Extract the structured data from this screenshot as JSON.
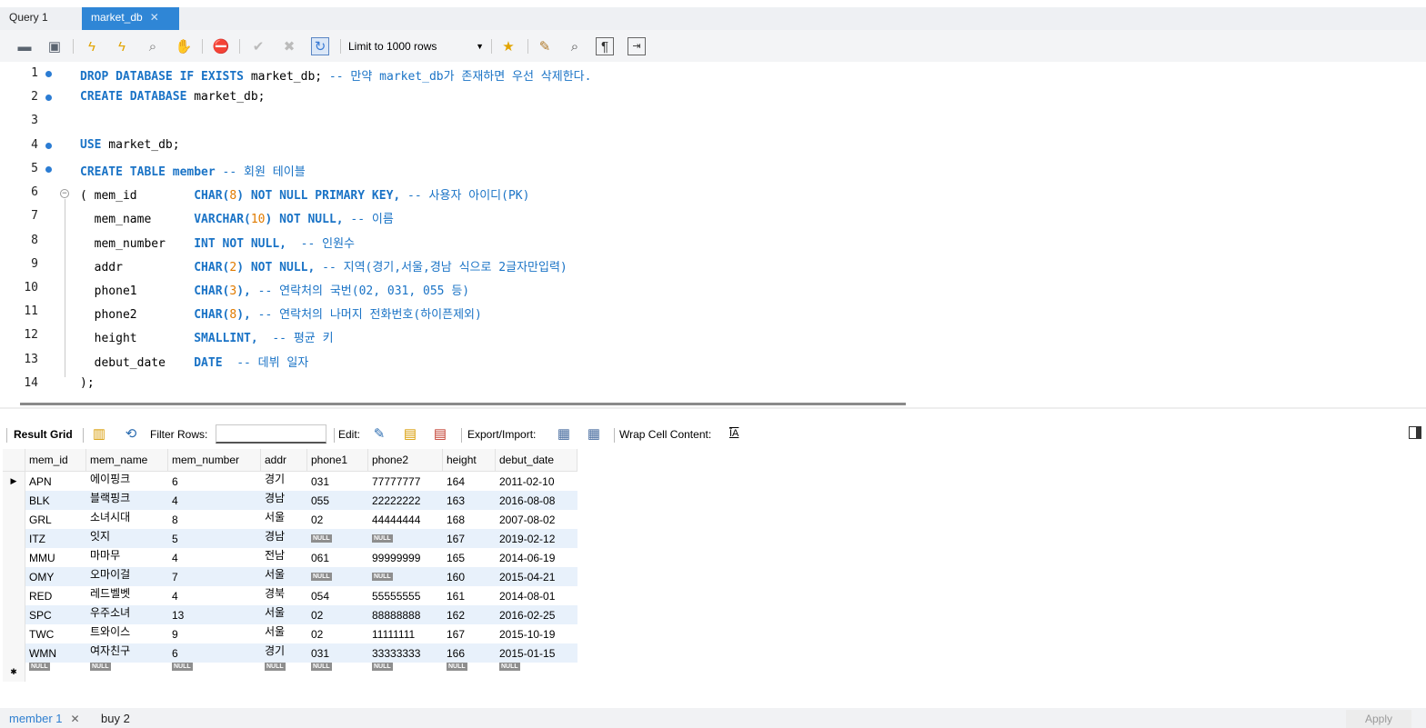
{
  "tabs": [
    {
      "label": "Query 1"
    },
    {
      "label": "market_db"
    }
  ],
  "toolbar": {
    "icons": [
      "open-folder-icon",
      "save-icon",
      "execute-icon",
      "execute-current-icon",
      "explain-icon",
      "stop-icon",
      "toggle-error-icon",
      "commit-icon",
      "rollback-icon",
      "autocommit-icon",
      "beautify-icon",
      "search-icon",
      "invisible-chars-icon",
      "wrap-icon"
    ],
    "limit_label": "Limit to 1000 rows"
  },
  "editor": {
    "lines": [
      {
        "n": "1",
        "dot": true
      },
      {
        "n": "2",
        "dot": true
      },
      {
        "n": "3",
        "dot": false
      },
      {
        "n": "4",
        "dot": true
      },
      {
        "n": "5",
        "dot": true
      },
      {
        "n": "6",
        "dot": false
      },
      {
        "n": "7",
        "dot": false
      },
      {
        "n": "8",
        "dot": false
      },
      {
        "n": "9",
        "dot": false
      },
      {
        "n": "10",
        "dot": false
      },
      {
        "n": "11",
        "dot": false
      },
      {
        "n": "12",
        "dot": false
      },
      {
        "n": "13",
        "dot": false
      },
      {
        "n": "14",
        "dot": false
      }
    ],
    "code": {
      "l1_kw": "DROP DATABASE IF EXISTS",
      "l1_id": " market_db;",
      "l1_cm": " -- 만약 market_db가 존재하면 우선 삭제한다.",
      "l2_kw": "CREATE DATABASE",
      "l2_id": " market_db;",
      "l4_kw": "USE",
      "l4_id": " market_db;",
      "l5_kw": "CREATE TABLE member",
      "l5_cm": " -- 회원 테이블",
      "l6_a": "( mem_id        ",
      "l6_kw1": "CHAR(",
      "l6_num": "8",
      "l6_kw2": ") NOT NULL PRIMARY KEY,",
      "l6_cm": " -- 사용자 아이디(PK)",
      "l7_a": "  mem_name      ",
      "l7_kw1": "VARCHAR(",
      "l7_num": "10",
      "l7_kw2": ") NOT NULL,",
      "l7_cm": " -- 이름",
      "l8_a": "  mem_number    ",
      "l8_kw": "INT NOT NULL,",
      "l8_cm": "  -- 인원수",
      "l9_a": "  addr          ",
      "l9_kw1": "CHAR(",
      "l9_num": "2",
      "l9_kw2": ") NOT NULL,",
      "l9_cm": " -- 지역(경기,서울,경남 식으로 2글자만입력)",
      "l10_a": "  phone1        ",
      "l10_kw1": "CHAR(",
      "l10_num": "3",
      "l10_kw2": "),",
      "l10_cm": " -- 연락처의 국번(02, 031, 055 등)",
      "l11_a": "  phone2        ",
      "l11_kw1": "CHAR(",
      "l11_num": "8",
      "l11_kw2": "),",
      "l11_cm": " -- 연락처의 나머지 전화번호(하이픈제외)",
      "l12_a": "  height        ",
      "l12_kw": "SMALLINT,",
      "l12_cm": "  -- 평균 키",
      "l13_a": "  debut_date    ",
      "l13_kw": "DATE",
      "l13_cm": "  -- 데뷔 일자",
      "l14_a": ");"
    }
  },
  "result_toolbar": {
    "result_grid": "Result Grid",
    "filter_rows": "Filter Rows:",
    "edit": "Edit:",
    "export_import": "Export/Import:",
    "wrap": "Wrap Cell Content:",
    "wrap_icon_glyph": "ĪA"
  },
  "grid": {
    "columns": [
      "mem_id",
      "mem_name",
      "mem_number",
      "addr",
      "phone1",
      "phone2",
      "height",
      "debut_date"
    ],
    "null_label": "NULL",
    "rows": [
      [
        "APN",
        "에이핑크",
        "6",
        "경기",
        "031",
        "77777777",
        "164",
        "2011-02-10"
      ],
      [
        "BLK",
        "블랙핑크",
        "4",
        "경남",
        "055",
        "22222222",
        "163",
        "2016-08-08"
      ],
      [
        "GRL",
        "소녀시대",
        "8",
        "서울",
        "02",
        "44444444",
        "168",
        "2007-08-02"
      ],
      [
        "ITZ",
        "잇지",
        "5",
        "경남",
        null,
        null,
        "167",
        "2019-02-12"
      ],
      [
        "MMU",
        "마마무",
        "4",
        "전남",
        "061",
        "99999999",
        "165",
        "2014-06-19"
      ],
      [
        "OMY",
        "오마이걸",
        "7",
        "서울",
        null,
        null,
        "160",
        "2015-04-21"
      ],
      [
        "RED",
        "레드벨벳",
        "4",
        "경북",
        "054",
        "55555555",
        "161",
        "2014-08-01"
      ],
      [
        "SPC",
        "우주소녀",
        "13",
        "서울",
        "02",
        "88888888",
        "162",
        "2016-02-25"
      ],
      [
        "TWC",
        "트와이스",
        "9",
        "서울",
        "02",
        "11111111",
        "167",
        "2015-10-19"
      ],
      [
        "WMN",
        "여자친구",
        "6",
        "경기",
        "031",
        "33333333",
        "166",
        "2015-01-15"
      ]
    ]
  },
  "bottom_tabs": [
    {
      "label": "member 1"
    },
    {
      "label": "buy 2"
    }
  ],
  "apply_label": "Apply"
}
